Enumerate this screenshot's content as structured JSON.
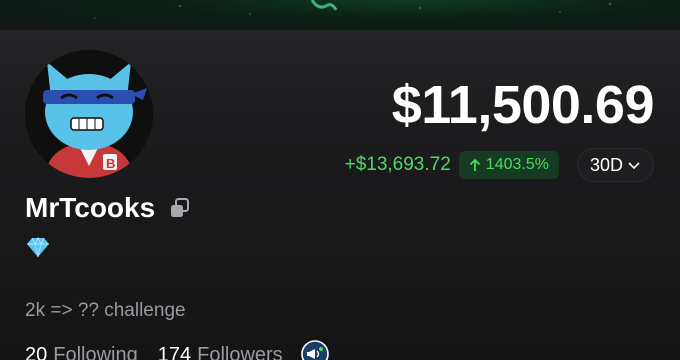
{
  "profile": {
    "username": "MrTcooks",
    "bio": "2k => ?? challenge",
    "avatar_icon": "avatar-blue-masked-character",
    "tier_icon": "diamond-icon"
  },
  "portfolio": {
    "balance": "$11,500.69",
    "pnl": "+$13,693.72",
    "pct_change": "1403.5%",
    "period": "30D"
  },
  "stats": {
    "following_count": "20",
    "following_label": "Following",
    "followers_count": "174",
    "followers_label": "Followers"
  },
  "colors": {
    "positive": "#4cd964",
    "background": "#111113",
    "muted_text": "#9a9aa0"
  }
}
